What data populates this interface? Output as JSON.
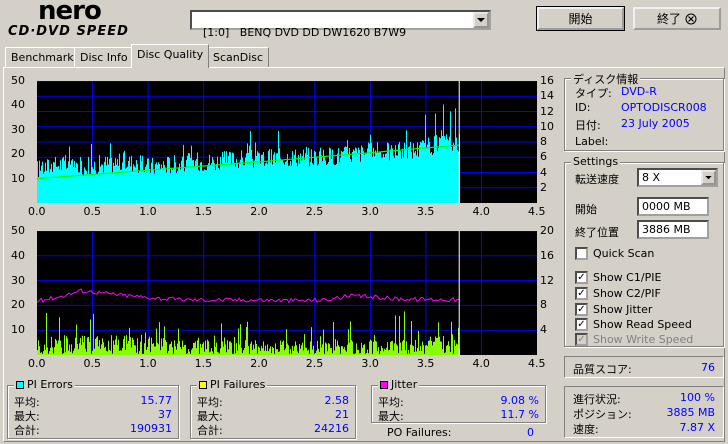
{
  "app": {
    "logo_top": "nero",
    "logo_bottom": "CD·DVD SPEED",
    "drive": "[1:0]   BENQ DVD DD DW1620 B7W9",
    "start_label": "開始",
    "exit_label": "終了"
  },
  "tabs": [
    {
      "label": "Benchmark",
      "active": false
    },
    {
      "label": "Disc Info",
      "active": false
    },
    {
      "label": "Disc Quality",
      "active": true
    },
    {
      "label": "ScanDisc",
      "active": false
    }
  ],
  "charts": {
    "x_ticks": [
      "0.0",
      "0.5",
      "1.0",
      "1.5",
      "2.0",
      "2.5",
      "3.0",
      "3.5",
      "4.0",
      "4.5"
    ],
    "top": {
      "left_ticks": [
        "50",
        "40",
        "30",
        "20",
        "10"
      ],
      "right_ticks": [
        "16",
        "14",
        "12",
        "10",
        "8",
        "6",
        "4",
        "2"
      ]
    },
    "bottom": {
      "left_ticks": [
        "50",
        "40",
        "30",
        "20",
        "10"
      ],
      "right_ticks": [
        "20",
        "16",
        "12",
        "8",
        "4"
      ]
    },
    "colors": {
      "pie": "#00ffff",
      "pif": "#88ff00",
      "jitter": "#ff00ff",
      "speed": "#00ff00",
      "grid": "#0000ff",
      "marker": "#ffffff"
    }
  },
  "chart_data": [
    {
      "type": "area",
      "title": "",
      "x_range": [
        0,
        4.5
      ],
      "y_left_range": [
        0,
        50
      ],
      "y_right_range": [
        0,
        16
      ],
      "scan_end": 3.8,
      "series": [
        {
          "name": "PI Errors",
          "x": [
            0.0,
            0.2,
            0.4,
            0.6,
            0.8,
            1.0,
            1.2,
            1.4,
            1.6,
            1.8,
            2.0,
            2.2,
            2.4,
            2.6,
            2.8,
            3.0,
            3.2,
            3.4,
            3.6,
            3.8
          ],
          "values": [
            14,
            16,
            15,
            16,
            17,
            15,
            16,
            17,
            17,
            18,
            18,
            19,
            19,
            19,
            20,
            21,
            21,
            22,
            24,
            25
          ]
        },
        {
          "name": "Read Speed",
          "x": [
            0.0,
            1.0,
            2.0,
            3.0,
            3.8
          ],
          "values": [
            3.2,
            4.3,
            5.4,
            6.6,
            7.6
          ]
        }
      ]
    },
    {
      "type": "area",
      "title": "",
      "x_range": [
        0,
        4.5
      ],
      "y_left_range": [
        0,
        50
      ],
      "y_right_range": [
        0,
        20
      ],
      "scan_end": 3.8,
      "series": [
        {
          "name": "PI Failures",
          "x": [
            0.0,
            0.2,
            0.4,
            0.6,
            0.8,
            1.0,
            1.2,
            1.4,
            1.6,
            1.8,
            2.0,
            2.2,
            2.4,
            2.6,
            2.8,
            3.0,
            3.2,
            3.4,
            3.6,
            3.8
          ],
          "values": [
            4,
            5,
            5,
            5,
            5,
            5,
            4,
            4,
            4,
            4,
            4,
            4,
            4,
            4,
            4,
            4,
            4,
            4,
            5,
            5
          ]
        },
        {
          "name": "Jitter",
          "x": [
            0.0,
            0.2,
            0.4,
            0.6,
            0.8,
            1.0,
            1.2,
            1.4,
            1.6,
            1.8,
            2.0,
            2.2,
            2.4,
            2.6,
            2.8,
            3.0,
            3.2,
            3.4,
            3.6,
            3.8
          ],
          "values": [
            8.7,
            9.4,
            10.4,
            10.0,
            9.6,
            9.3,
            9.0,
            8.9,
            8.9,
            8.9,
            8.9,
            8.8,
            8.8,
            8.9,
            9.5,
            9.4,
            9.1,
            9.0,
            9.0,
            8.9
          ]
        }
      ]
    }
  ],
  "disc_info": {
    "title": "ディスク情報",
    "rows": [
      {
        "label": "タイプ:",
        "value": "DVD-R"
      },
      {
        "label": "ID:",
        "value": "OPTODISCR008"
      },
      {
        "label": "日付:",
        "value": "23 July 2005"
      },
      {
        "label": "Label:",
        "value": ""
      }
    ]
  },
  "settings": {
    "title": "Settings",
    "speed_label": "転送速度",
    "speed_value": "8 X",
    "start_label": "開始",
    "start_value": "0000 MB",
    "end_label": "終了位置",
    "end_value": "3886 MB",
    "checks": [
      {
        "label": "Quick Scan",
        "checked": false,
        "disabled": false
      },
      {
        "label": "Show C1/PIE",
        "checked": true,
        "disabled": false
      },
      {
        "label": "Show C2/PIF",
        "checked": true,
        "disabled": false
      },
      {
        "label": "Show Jitter",
        "checked": true,
        "disabled": false
      },
      {
        "label": "Show Read Speed",
        "checked": true,
        "disabled": false
      },
      {
        "label": "Show Write Speed",
        "checked": true,
        "disabled": true
      }
    ]
  },
  "quality": {
    "label": "品質スコア:",
    "value": "76"
  },
  "progress": {
    "rows": [
      {
        "label": "進行状況:",
        "value": "100 %"
      },
      {
        "label": "ポジション:",
        "value": "3885 MB"
      },
      {
        "label": "速度:",
        "value": "7.87 X"
      }
    ]
  },
  "pi_errors": {
    "title": "PI Errors",
    "rows": [
      {
        "label": "平均:",
        "value": "15.77"
      },
      {
        "label": "最大:",
        "value": "37"
      },
      {
        "label": "合計:",
        "value": "190931"
      }
    ]
  },
  "pi_failures": {
    "title": "PI Failures",
    "rows": [
      {
        "label": "平均:",
        "value": "2.58"
      },
      {
        "label": "最大:",
        "value": "21"
      },
      {
        "label": "合計:",
        "value": "24216"
      }
    ]
  },
  "jitter": {
    "title": "Jitter",
    "rows": [
      {
        "label": "平均:",
        "value": "9.08 %"
      },
      {
        "label": "最大:",
        "value": "11.7 %"
      }
    ],
    "po_label": "PO Failures:",
    "po_value": "0"
  }
}
